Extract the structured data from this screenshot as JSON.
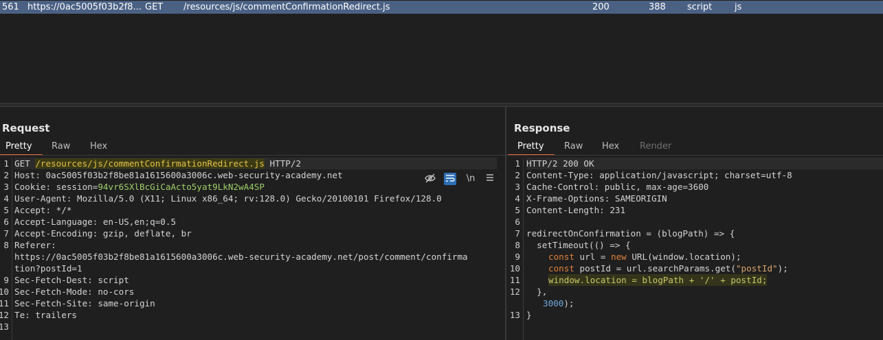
{
  "history_row": {
    "id": "561",
    "host": "https://0ac5005f03b2f8...",
    "method": "GET",
    "url": "/resources/js/commentConfirmationRedirect.js",
    "status": "200",
    "length": "388",
    "mime": "script",
    "ext": "js"
  },
  "request": {
    "title": "Request",
    "tabs": [
      "Pretty",
      "Raw",
      "Hex"
    ],
    "tools": [
      "eye-off-icon",
      "wrap-icon",
      "newline-icon",
      "menu-icon"
    ],
    "tool_labels": {
      "newline": "\\n"
    },
    "line_numbers": [
      "1",
      "2",
      "3",
      "4",
      "5",
      "6",
      "7",
      "8",
      "",
      "",
      "9",
      "10",
      "11",
      "12",
      "13"
    ],
    "lines": {
      "l1_method": "GET ",
      "l1_path": "/resources/js/commentConfirmationRedirect.js",
      "l1_proto": " HTTP/2",
      "l2": "Host: 0ac5005f03b2f8be81a1615600a3006c.web-security-academy.net",
      "l3_key": "Cookie: session=",
      "l3_val": "94vr6SXlBcGiCaActo5yat9LkN2wA4SP",
      "l4": "User-Agent: Mozilla/5.0 (X11; Linux x86_64; rv:128.0) Gecko/20100101 Firefox/128.0",
      "l5": "Accept: */*",
      "l6": "Accept-Language: en-US,en;q=0.5",
      "l7": "Accept-Encoding: gzip, deflate, br",
      "l8": "Referer:",
      "l8b": "https://0ac5005f03b2f8be81a1615600a3006c.web-security-academy.net/post/comment/confirma",
      "l8c": "tion?postId=1",
      "l9": "Sec-Fetch-Dest: script",
      "l10": "Sec-Fetch-Mode: no-cors",
      "l11": "Sec-Fetch-Site: same-origin",
      "l12": "Te: trailers",
      "l13": ""
    }
  },
  "response": {
    "title": "Response",
    "tabs": [
      "Pretty",
      "Raw",
      "Hex",
      "Render"
    ],
    "line_numbers": [
      "1",
      "2",
      "3",
      "4",
      "5",
      "6",
      "7",
      "8",
      "9",
      "10",
      "11",
      "12",
      "",
      "13"
    ],
    "lines": {
      "l1": "HTTP/2 200 OK",
      "l2": "Content-Type: application/javascript; charset=utf-8",
      "l3": "Cache-Control: public, max-age=3600",
      "l4": "X-Frame-Options: SAMEORIGIN",
      "l5": "Content-Length: 231",
      "l6": "",
      "l7": "redirectOnConfirmation = (blogPath) => {",
      "l8": "  setTimeout(() => {",
      "l9_kw": "const",
      "l9_a": " url = ",
      "l9_new": "new",
      "l9_b": " URL(window.location);",
      "l10_kw": "const",
      "l10_a": " postId = url.searchParams.get(",
      "l10_str": "\"postId\"",
      "l10_b": ");",
      "l11": "window.location = blogPath + '/' + postId;",
      "l12": "  },",
      "l12b": "3000",
      "l12c": ");",
      "l13": "}"
    }
  }
}
